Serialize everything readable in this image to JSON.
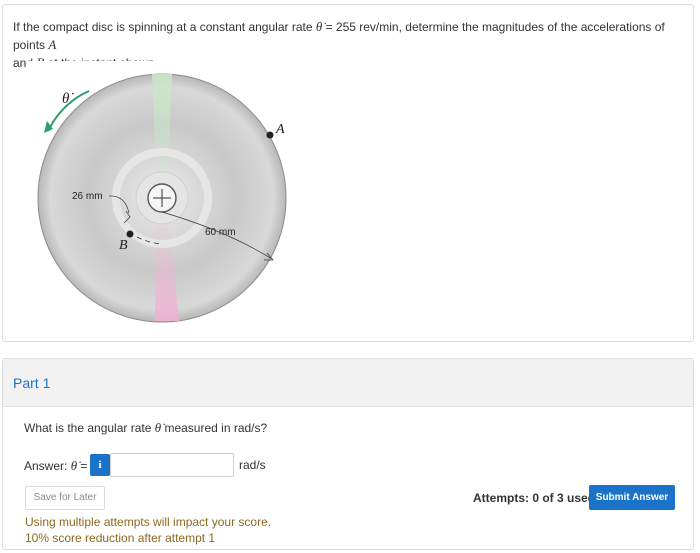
{
  "question": {
    "text_before_symbol": "If the compact disc is spinning at a constant angular rate ",
    "symbol": "θ̇",
    "text_after_symbol": " = 255 rev/min, determine the magnitudes of the accelerations of points ",
    "point_a": "A",
    "and_text": " and ",
    "point_b": "B",
    "end_text": " at the instant shown."
  },
  "figure": {
    "theta_dot_label": "θ̇",
    "label_a": "A",
    "label_b": "B",
    "dim_26": "26 mm",
    "dim_60": "60 mm",
    "arrow_color": "#2a9d6a"
  },
  "part": {
    "title": "Part 1",
    "question_before": "What is the angular rate ",
    "question_symbol": "θ̇",
    "question_after": " measured in rad/s?",
    "answer_label": "Answer: ",
    "answer_symbol": "θ̇",
    "answer_equals": " =",
    "info_label": "i",
    "answer_value": "",
    "unit": "rad/s",
    "save_label": "Save for Later",
    "attempts_text": "Attempts: 0 of 3 used",
    "submit_label": "Submit Answer",
    "warning_line1": "Using multiple attempts will impact your score.",
    "warning_line2": "10% score reduction after attempt 1"
  },
  "colors": {
    "accent": "#1a73c8",
    "warning": "#8a6a1e"
  }
}
